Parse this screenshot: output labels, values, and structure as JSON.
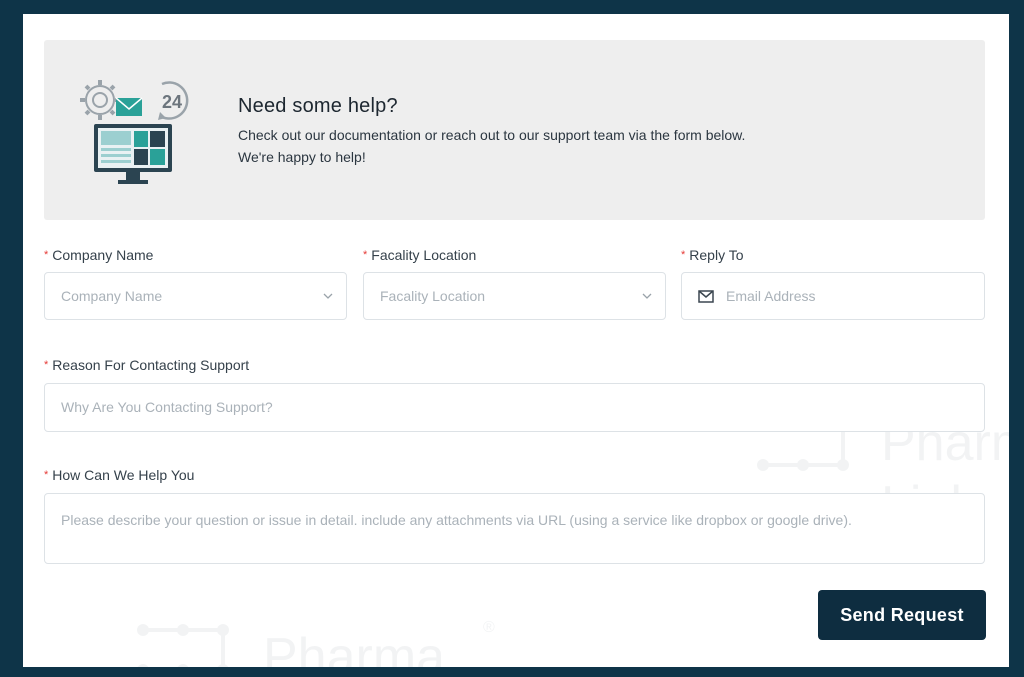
{
  "help": {
    "title": "Need some help?",
    "description": "Check out our documentation or reach out to our support team via the form below. We're happy to help!",
    "badge_text": "24"
  },
  "form": {
    "company": {
      "required_mark": "*",
      "label": "Company Name",
      "placeholder": "Company Name"
    },
    "location": {
      "required_mark": "*",
      "label": "Facality Location",
      "placeholder": "Facality Location"
    },
    "reply": {
      "required_mark": "*",
      "label": "Reply To",
      "placeholder": "Email Address"
    },
    "reason": {
      "required_mark": "*",
      "label": "Reason For Contacting Support",
      "placeholder": "Why Are You Contacting Support?"
    },
    "details": {
      "required_mark": "*",
      "label": "How Can We Help You",
      "placeholder": "Please describe your question or issue in detail. include any attachments via URL (using a service like dropbox or google drive)."
    },
    "submit_label": "Send Request"
  },
  "watermark": {
    "word1": "Pharma",
    "word2": "Link",
    "registered": "®"
  },
  "colors": {
    "page_background": "#0e3448",
    "panel": "#ffffff",
    "banner": "#eeeeee",
    "button": "#0e2d40",
    "required": "#e53935",
    "accent_teal": "#2aa198"
  }
}
